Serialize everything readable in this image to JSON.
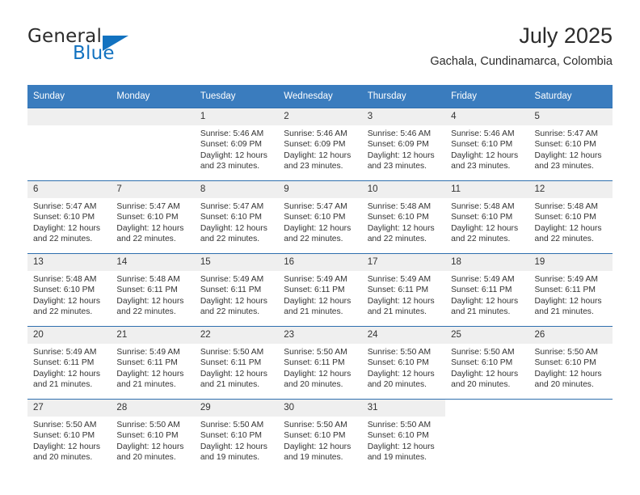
{
  "brand": {
    "name_dark": "General",
    "name_blue": "Blue"
  },
  "header": {
    "title": "July 2025",
    "subtitle": "Gachala, Cundinamarca, Colombia"
  },
  "calendar": {
    "weekday_headers": [
      "Sunday",
      "Monday",
      "Tuesday",
      "Wednesday",
      "Thursday",
      "Friday",
      "Saturday"
    ],
    "colors": {
      "header_blue": "#3a7cbe",
      "row_rule_blue": "#2f6fae",
      "daynum_band": "#efefef",
      "brand_blue": "#1272c0"
    },
    "weeks": [
      [
        {
          "day": "",
          "lines": []
        },
        {
          "day": "",
          "lines": []
        },
        {
          "day": "1",
          "lines": [
            "Sunrise: 5:46 AM",
            "Sunset: 6:09 PM",
            "Daylight: 12 hours",
            "and 23 minutes."
          ]
        },
        {
          "day": "2",
          "lines": [
            "Sunrise: 5:46 AM",
            "Sunset: 6:09 PM",
            "Daylight: 12 hours",
            "and 23 minutes."
          ]
        },
        {
          "day": "3",
          "lines": [
            "Sunrise: 5:46 AM",
            "Sunset: 6:09 PM",
            "Daylight: 12 hours",
            "and 23 minutes."
          ]
        },
        {
          "day": "4",
          "lines": [
            "Sunrise: 5:46 AM",
            "Sunset: 6:10 PM",
            "Daylight: 12 hours",
            "and 23 minutes."
          ]
        },
        {
          "day": "5",
          "lines": [
            "Sunrise: 5:47 AM",
            "Sunset: 6:10 PM",
            "Daylight: 12 hours",
            "and 23 minutes."
          ]
        }
      ],
      [
        {
          "day": "6",
          "lines": [
            "Sunrise: 5:47 AM",
            "Sunset: 6:10 PM",
            "Daylight: 12 hours",
            "and 22 minutes."
          ]
        },
        {
          "day": "7",
          "lines": [
            "Sunrise: 5:47 AM",
            "Sunset: 6:10 PM",
            "Daylight: 12 hours",
            "and 22 minutes."
          ]
        },
        {
          "day": "8",
          "lines": [
            "Sunrise: 5:47 AM",
            "Sunset: 6:10 PM",
            "Daylight: 12 hours",
            "and 22 minutes."
          ]
        },
        {
          "day": "9",
          "lines": [
            "Sunrise: 5:47 AM",
            "Sunset: 6:10 PM",
            "Daylight: 12 hours",
            "and 22 minutes."
          ]
        },
        {
          "day": "10",
          "lines": [
            "Sunrise: 5:48 AM",
            "Sunset: 6:10 PM",
            "Daylight: 12 hours",
            "and 22 minutes."
          ]
        },
        {
          "day": "11",
          "lines": [
            "Sunrise: 5:48 AM",
            "Sunset: 6:10 PM",
            "Daylight: 12 hours",
            "and 22 minutes."
          ]
        },
        {
          "day": "12",
          "lines": [
            "Sunrise: 5:48 AM",
            "Sunset: 6:10 PM",
            "Daylight: 12 hours",
            "and 22 minutes."
          ]
        }
      ],
      [
        {
          "day": "13",
          "lines": [
            "Sunrise: 5:48 AM",
            "Sunset: 6:10 PM",
            "Daylight: 12 hours",
            "and 22 minutes."
          ]
        },
        {
          "day": "14",
          "lines": [
            "Sunrise: 5:48 AM",
            "Sunset: 6:11 PM",
            "Daylight: 12 hours",
            "and 22 minutes."
          ]
        },
        {
          "day": "15",
          "lines": [
            "Sunrise: 5:49 AM",
            "Sunset: 6:11 PM",
            "Daylight: 12 hours",
            "and 22 minutes."
          ]
        },
        {
          "day": "16",
          "lines": [
            "Sunrise: 5:49 AM",
            "Sunset: 6:11 PM",
            "Daylight: 12 hours",
            "and 21 minutes."
          ]
        },
        {
          "day": "17",
          "lines": [
            "Sunrise: 5:49 AM",
            "Sunset: 6:11 PM",
            "Daylight: 12 hours",
            "and 21 minutes."
          ]
        },
        {
          "day": "18",
          "lines": [
            "Sunrise: 5:49 AM",
            "Sunset: 6:11 PM",
            "Daylight: 12 hours",
            "and 21 minutes."
          ]
        },
        {
          "day": "19",
          "lines": [
            "Sunrise: 5:49 AM",
            "Sunset: 6:11 PM",
            "Daylight: 12 hours",
            "and 21 minutes."
          ]
        }
      ],
      [
        {
          "day": "20",
          "lines": [
            "Sunrise: 5:49 AM",
            "Sunset: 6:11 PM",
            "Daylight: 12 hours",
            "and 21 minutes."
          ]
        },
        {
          "day": "21",
          "lines": [
            "Sunrise: 5:49 AM",
            "Sunset: 6:11 PM",
            "Daylight: 12 hours",
            "and 21 minutes."
          ]
        },
        {
          "day": "22",
          "lines": [
            "Sunrise: 5:50 AM",
            "Sunset: 6:11 PM",
            "Daylight: 12 hours",
            "and 21 minutes."
          ]
        },
        {
          "day": "23",
          "lines": [
            "Sunrise: 5:50 AM",
            "Sunset: 6:11 PM",
            "Daylight: 12 hours",
            "and 20 minutes."
          ]
        },
        {
          "day": "24",
          "lines": [
            "Sunrise: 5:50 AM",
            "Sunset: 6:10 PM",
            "Daylight: 12 hours",
            "and 20 minutes."
          ]
        },
        {
          "day": "25",
          "lines": [
            "Sunrise: 5:50 AM",
            "Sunset: 6:10 PM",
            "Daylight: 12 hours",
            "and 20 minutes."
          ]
        },
        {
          "day": "26",
          "lines": [
            "Sunrise: 5:50 AM",
            "Sunset: 6:10 PM",
            "Daylight: 12 hours",
            "and 20 minutes."
          ]
        }
      ],
      [
        {
          "day": "27",
          "lines": [
            "Sunrise: 5:50 AM",
            "Sunset: 6:10 PM",
            "Daylight: 12 hours",
            "and 20 minutes."
          ]
        },
        {
          "day": "28",
          "lines": [
            "Sunrise: 5:50 AM",
            "Sunset: 6:10 PM",
            "Daylight: 12 hours",
            "and 20 minutes."
          ]
        },
        {
          "day": "29",
          "lines": [
            "Sunrise: 5:50 AM",
            "Sunset: 6:10 PM",
            "Daylight: 12 hours",
            "and 19 minutes."
          ]
        },
        {
          "day": "30",
          "lines": [
            "Sunrise: 5:50 AM",
            "Sunset: 6:10 PM",
            "Daylight: 12 hours",
            "and 19 minutes."
          ]
        },
        {
          "day": "31",
          "lines": [
            "Sunrise: 5:50 AM",
            "Sunset: 6:10 PM",
            "Daylight: 12 hours",
            "and 19 minutes."
          ]
        },
        {
          "day": "",
          "lines": []
        },
        {
          "day": "",
          "lines": []
        }
      ]
    ]
  }
}
